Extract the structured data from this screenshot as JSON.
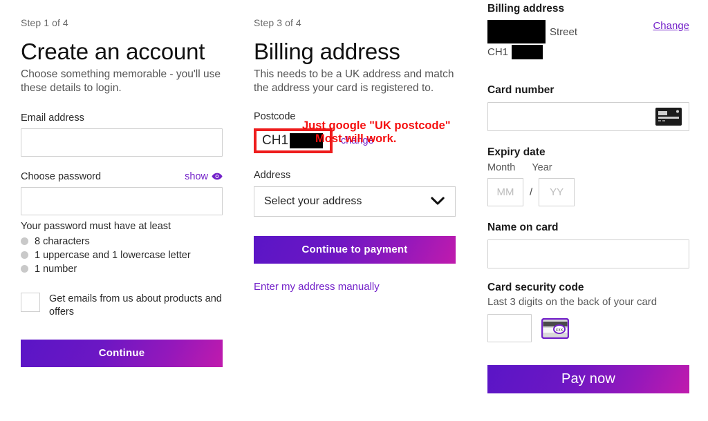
{
  "left_column": {
    "step": "Step 1 of 4",
    "heading": "Create an account",
    "subtext": "Choose something memorable - you'll use these details to login.",
    "email_label": "Email address",
    "email_value": "",
    "password_label": "Choose password",
    "show_label": "show",
    "password_value": "",
    "requirements_title": "Your password must have at least",
    "requirements": [
      "8 characters",
      "1 uppercase and 1 lowercase letter",
      "1 number"
    ],
    "marketing_checkbox_label": "Get emails from us about products and offers",
    "marketing_checked": false,
    "continue_label": "Continue"
  },
  "middle_column": {
    "step": "Step 3 of 4",
    "heading": "Billing address",
    "subtext": "This needs to be a UK address and match the address your card is registered to.",
    "postcode_label": "Postcode",
    "postcode_value": "CH1",
    "change_label": "change",
    "annotation_line1": "Just google \"UK postcode\"",
    "annotation_line2": "Most will work.",
    "address_label": "Address",
    "address_select_value": "Select your address",
    "continue_payment_label": "Continue to payment",
    "manual_address_label": "Enter my address manually"
  },
  "right_column": {
    "billing_address_title": "Billing address",
    "address_street_suffix": "Street",
    "address_postcode_prefix": "CH1",
    "change_label": "Change",
    "card_number_label": "Card number",
    "card_number_value": "",
    "expiry_title": "Expiry date",
    "month_label": "Month",
    "year_label": "Year",
    "month_placeholder": "MM",
    "year_placeholder": "YY",
    "month_value": "",
    "year_value": "",
    "separator": "/",
    "name_on_card_label": "Name on card",
    "name_on_card_value": "",
    "security_code_label": "Card security code",
    "security_code_hint": "Last 3 digits on the back of your card",
    "security_code_value": "",
    "pay_now_label": "Pay now"
  },
  "colors": {
    "link_purple": "#7321c9",
    "annotation_red": "#f50f0f",
    "button_gradient_start": "#5a15c6",
    "button_gradient_end": "#c01bad",
    "redaction_black": "#000000"
  }
}
